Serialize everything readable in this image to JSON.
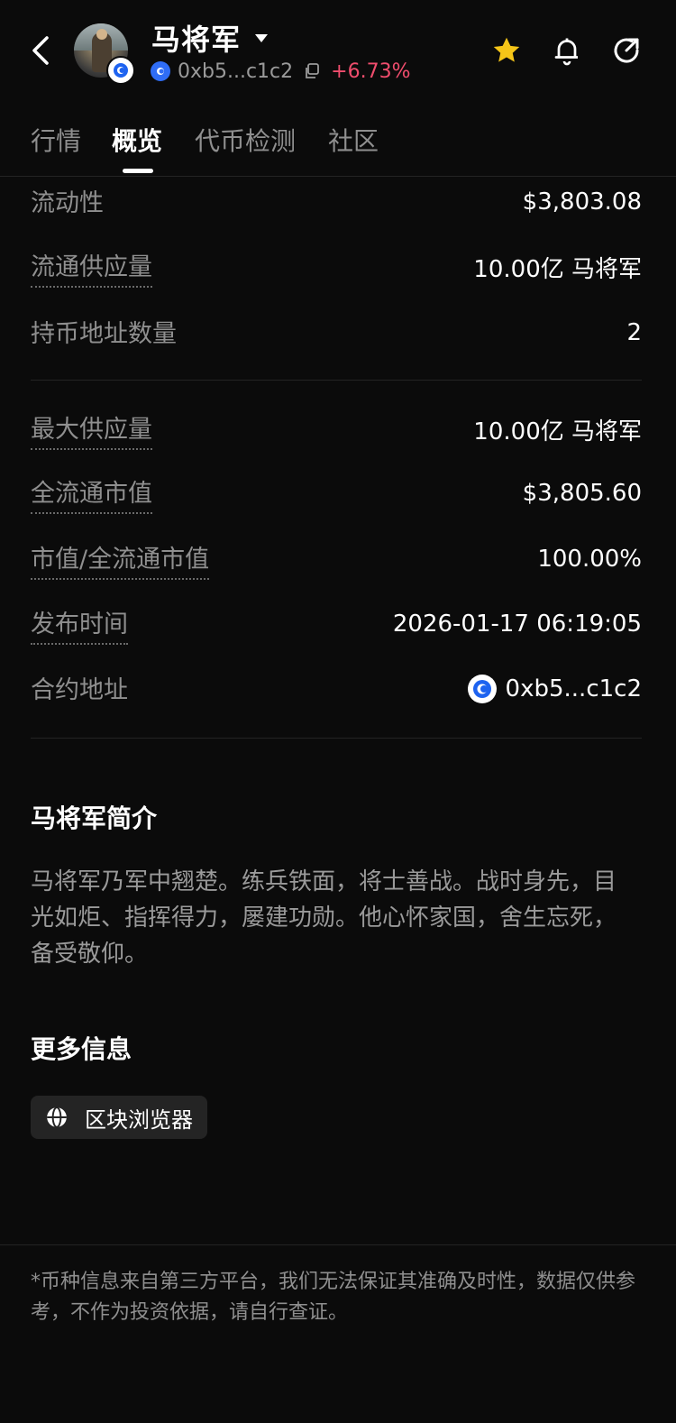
{
  "header": {
    "title": "马将军",
    "address": "0xb5...c1c2",
    "change": "+6.73%",
    "change_color": "#f04d6d",
    "accent_star_color": "#f5c518",
    "icons": [
      "back-icon",
      "dropdown-caret-icon",
      "copy-icon",
      "star-icon",
      "bell-icon",
      "share-icon"
    ]
  },
  "tabs": [
    {
      "label": "行情",
      "active": false
    },
    {
      "label": "概览",
      "active": true
    },
    {
      "label": "代币检测",
      "active": false
    },
    {
      "label": "社区",
      "active": false
    }
  ],
  "stats": [
    {
      "label": "流动性",
      "value": "$3,803.08"
    },
    {
      "label": "流通供应量",
      "value": "10.00亿 马将军"
    },
    {
      "label": "持币地址数量",
      "value": "2"
    },
    {
      "label": "最大供应量",
      "value": "10.00亿 马将军"
    },
    {
      "label": "全流通市值",
      "value": "$3,805.60"
    },
    {
      "label": "市值/全流通市值",
      "value": "100.00%"
    },
    {
      "label": "发布时间",
      "value": "2026-01-17 06:19:05"
    },
    {
      "label": "合约地址",
      "value": "0xb5...c1c2"
    }
  ],
  "intro": {
    "title": "马将军简介",
    "text": "马将军乃军中翘楚。练兵铁面，将士善战。战时身先，目光如炬、指挥得力，屡建功勋。他心怀家国，舍生忘死，备受敬仰。"
  },
  "more": {
    "title": "更多信息",
    "explorer_label": "区块浏览器"
  },
  "disclaimer": "*币种信息来自第三方平台，我们无法保证其准确及时性，数据仅供参考，不作为投资依据，请自行查证。"
}
